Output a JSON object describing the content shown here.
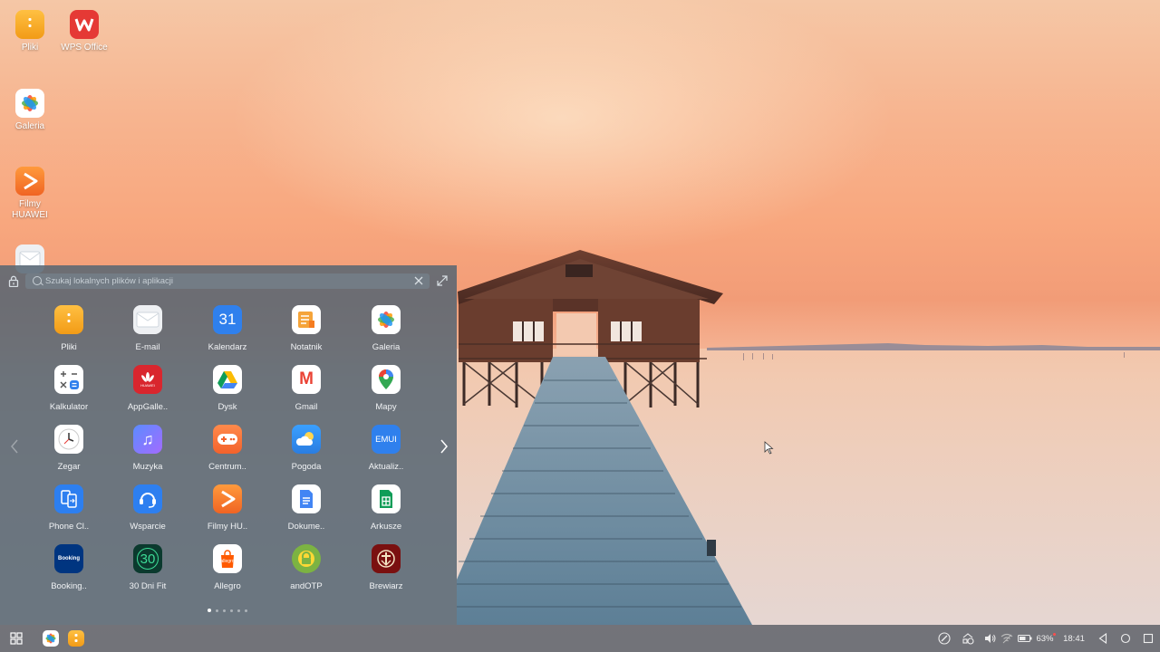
{
  "desktop": {
    "icons": [
      {
        "label": "Pliki",
        "icon": "files-icon",
        "color": "#f6a821"
      },
      {
        "label": "WPS Office",
        "icon": "wps-office-icon",
        "color": "#e53935"
      },
      {
        "label": "Galeria",
        "icon": "gallery-icon",
        "color": "#ffffff"
      },
      {
        "label": "Filmy\nHUAWEI",
        "icon": "video-play-icon",
        "color": "#f57c30"
      },
      {
        "label": "",
        "icon": "email-icon",
        "color": "#eef0f3"
      }
    ]
  },
  "start_menu": {
    "search": {
      "placeholder": "Szukaj lokalnych plików i aplikacji",
      "value": ""
    },
    "apps": [
      {
        "label": "Pliki",
        "icon": "files-icon"
      },
      {
        "label": "E-mail",
        "icon": "email-icon"
      },
      {
        "label": "Kalendarz",
        "icon": "calendar-icon",
        "glyph": "31"
      },
      {
        "label": "Notatnik",
        "icon": "notepad-icon"
      },
      {
        "label": "Galeria",
        "icon": "gallery-icon"
      },
      {
        "label": "Kalkulator",
        "icon": "calculator-icon"
      },
      {
        "label": "AppGalle..",
        "icon": "appgallery-icon",
        "glyph": "HUAWEI"
      },
      {
        "label": "Dysk",
        "icon": "drive-icon"
      },
      {
        "label": "Gmail",
        "icon": "gmail-icon",
        "glyph": "M"
      },
      {
        "label": "Mapy",
        "icon": "maps-icon"
      },
      {
        "label": "Zegar",
        "icon": "clock-icon"
      },
      {
        "label": "Muzyka",
        "icon": "music-icon",
        "glyph": "♫"
      },
      {
        "label": "Centrum..",
        "icon": "game-center-icon"
      },
      {
        "label": "Pogoda",
        "icon": "weather-icon"
      },
      {
        "label": "Aktualiz..",
        "icon": "emui-update-icon",
        "glyph": "EMUI"
      },
      {
        "label": "Phone Cl..",
        "icon": "phone-clone-icon"
      },
      {
        "label": "Wsparcie",
        "icon": "support-icon"
      },
      {
        "label": "Filmy HU..",
        "icon": "video-play-icon"
      },
      {
        "label": "Dokume..",
        "icon": "docs-icon"
      },
      {
        "label": "Arkusze",
        "icon": "sheets-icon"
      },
      {
        "label": "Booking..",
        "icon": "booking-icon",
        "glyph": "Booking"
      },
      {
        "label": "30 Dni Fit",
        "icon": "fitness-30-icon",
        "glyph": "30"
      },
      {
        "label": "Allegro",
        "icon": "allegro-icon",
        "glyph": "allegro"
      },
      {
        "label": "andOTP",
        "icon": "andotp-icon"
      },
      {
        "label": "Brewiarz",
        "icon": "brewiarz-icon"
      }
    ],
    "pages": {
      "count": 6,
      "current": 1
    }
  },
  "taskbar": {
    "pinned": [
      {
        "icon": "gallery-icon"
      },
      {
        "icon": "files-icon"
      }
    ],
    "battery_percent": "63%",
    "time": "18:41"
  },
  "colors": {
    "accent_orange": "#f6a821",
    "panel_bg": "#566572",
    "taskbar_bg": "#686a71"
  }
}
